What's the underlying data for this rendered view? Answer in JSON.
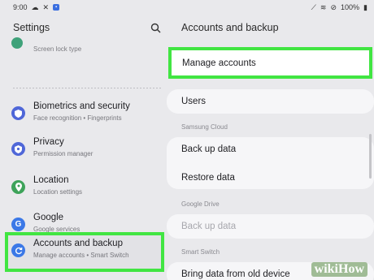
{
  "status_bar": {
    "time": "9:00",
    "battery": "100%",
    "left_icons": [
      "cloud-icon",
      "mute-icon",
      "app-icon"
    ],
    "right_icons": [
      "edit-icon",
      "wifi-icon",
      "dnd-icon",
      "battery-icon"
    ]
  },
  "left_panel": {
    "title": "Settings",
    "partial_item": {
      "subtitle": "Screen lock type"
    },
    "items": [
      {
        "title": "Biometrics and security",
        "subtitle": "Face recognition  •  Fingerprints",
        "icon": "shield-icon",
        "color": "#4f67d8"
      },
      {
        "title": "Privacy",
        "subtitle": "Permission manager",
        "icon": "privacy-shield-icon",
        "color": "#4f67d8"
      },
      {
        "title": "Location",
        "subtitle": "Location settings",
        "icon": "location-pin-icon",
        "color": "#3ea35a"
      },
      {
        "title": "Google",
        "subtitle": "Google services",
        "icon": "google-icon",
        "color": "#3b78e7"
      },
      {
        "title": "Accounts and backup",
        "subtitle": "Manage accounts  •  Smart Switch",
        "icon": "sync-icon",
        "color": "#3b78e7"
      }
    ]
  },
  "right_panel": {
    "title": "Accounts and backup",
    "manage_accounts": "Manage accounts",
    "users": "Users",
    "samsung_cloud_header": "Samsung Cloud",
    "back_up_data": "Back up data",
    "restore_data": "Restore data",
    "google_drive_header": "Google Drive",
    "gd_back_up_data": "Back up data",
    "smart_switch_header": "Smart Switch",
    "bring_data": "Bring data from old device"
  },
  "colors": {
    "highlight": "#41e542",
    "background": "#e9e9ec",
    "card": "#f6f6f8"
  },
  "watermark": "wikiHow"
}
